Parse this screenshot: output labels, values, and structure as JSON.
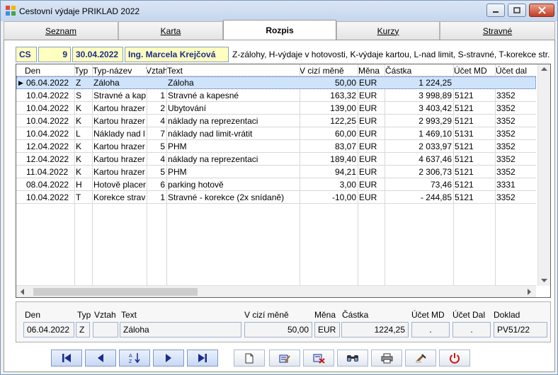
{
  "window": {
    "title": "Cestovní výdaje PRIKLAD 2022"
  },
  "tabs": [
    {
      "label": "Seznam"
    },
    {
      "label": "Karta"
    },
    {
      "label": "Rozpis"
    },
    {
      "label": "Kurzy"
    },
    {
      "label": "Stravné"
    }
  ],
  "header": {
    "code": "CS",
    "number": "9",
    "date": "30.04.2022",
    "person": "Ing. Marcela Krejčová",
    "legend": "Z-zálohy, H-výdaje v hotovosti, K-výdaje kartou, L-nad limit, S-stravné, T-korekce str."
  },
  "grid": {
    "columns": [
      "Den",
      "Typ",
      "Typ-název",
      "Vztah",
      "Text",
      "V cizí měně",
      "Měna",
      "Částka",
      "Účet MD",
      "Účet dal"
    ],
    "rows": [
      {
        "den": "06.04.2022",
        "typ": "Z",
        "nazev": "Záloha",
        "vztah": "",
        "text": "Záloha",
        "cizi": "50,00",
        "mena": "EUR",
        "castka": "1 224,25",
        "md": "",
        "dal": ""
      },
      {
        "den": "10.04.2022",
        "typ": "S",
        "nazev": "Stravné a kap",
        "vztah": "1",
        "text": "Stravné a kapesné",
        "cizi": "163,32",
        "mena": "EUR",
        "castka": "3 998,89",
        "md": "5121",
        "dal": "3352"
      },
      {
        "den": "10.04.2022",
        "typ": "K",
        "nazev": "Kartou hrazer",
        "vztah": "2",
        "text": "Ubytování",
        "cizi": "139,00",
        "mena": "EUR",
        "castka": "3 403,42",
        "md": "5121",
        "dal": "3352"
      },
      {
        "den": "10.04.2022",
        "typ": "K",
        "nazev": "Kartou hrazer",
        "vztah": "4",
        "text": "náklady na reprezentaci",
        "cizi": "122,25",
        "mena": "EUR",
        "castka": "2 993,29",
        "md": "5121",
        "dal": "3352"
      },
      {
        "den": "10.04.2022",
        "typ": "L",
        "nazev": "Náklady nad l",
        "vztah": "7",
        "text": "náklady nad limit-vrátit",
        "cizi": "60,00",
        "mena": "EUR",
        "castka": "1 469,10",
        "md": "5131",
        "dal": "3352"
      },
      {
        "den": "12.04.2022",
        "typ": "K",
        "nazev": "Kartou hrazer",
        "vztah": "5",
        "text": "PHM",
        "cizi": "83,07",
        "mena": "EUR",
        "castka": "2 033,97",
        "md": "5121",
        "dal": "3352"
      },
      {
        "den": "12.04.2022",
        "typ": "K",
        "nazev": "Kartou hrazer",
        "vztah": "4",
        "text": "náklady na reprezentaci",
        "cizi": "189,40",
        "mena": "EUR",
        "castka": "4 637,46",
        "md": "5121",
        "dal": "3352"
      },
      {
        "den": "11.04.2022",
        "typ": "K",
        "nazev": "Kartou hrazer",
        "vztah": "5",
        "text": "PHM",
        "cizi": "94,21",
        "mena": "EUR",
        "castka": "2 306,73",
        "md": "5121",
        "dal": "3352"
      },
      {
        "den": "08.04.2022",
        "typ": "H",
        "nazev": "Hotově placen",
        "vztah": "6",
        "text": "parking hotově",
        "cizi": "3,00",
        "mena": "EUR",
        "castka": "73,46",
        "md": "5121",
        "dal": "3331"
      },
      {
        "den": "10.04.2022",
        "typ": "T",
        "nazev": "Korekce strav",
        "vztah": "1",
        "text": "Stravné - korekce (2x snídaně)",
        "cizi": "-10,00",
        "mena": "EUR",
        "castka": "- 244,85",
        "md": "5121",
        "dal": "3352"
      }
    ]
  },
  "detail": {
    "labels": {
      "den": "Den",
      "typ": "Typ",
      "vztah": "Vztah",
      "text": "Text",
      "cizi": "V cizí měně",
      "mena": "Měna",
      "castka": "Částka",
      "md": "Účet MD",
      "dal": "Účet Dal",
      "doklad": "Doklad"
    },
    "values": {
      "den": "06.04.2022",
      "typ": "Z",
      "vztah": "",
      "text": "Záloha",
      "cizi": "50,00",
      "mena": "EUR",
      "castka": "1224,25",
      "md": ".",
      "dal": ".",
      "doklad": "PV51/22"
    }
  },
  "toolbar": [
    {
      "icon": "first-record-icon"
    },
    {
      "icon": "previous-record-icon"
    },
    {
      "icon": "sort-az-icon"
    },
    {
      "icon": "next-record-icon"
    },
    {
      "icon": "last-record-icon"
    },
    {
      "icon": "new-document-icon"
    },
    {
      "icon": "edit-icon"
    },
    {
      "icon": "delete-icon"
    },
    {
      "icon": "find-icon"
    },
    {
      "icon": "print-icon"
    },
    {
      "icon": "tools-icon"
    },
    {
      "icon": "exit-icon"
    }
  ],
  "colors": {
    "accent": "#1a2d8a",
    "selected_row": "#cfe3fb",
    "close": "#c43c22"
  }
}
